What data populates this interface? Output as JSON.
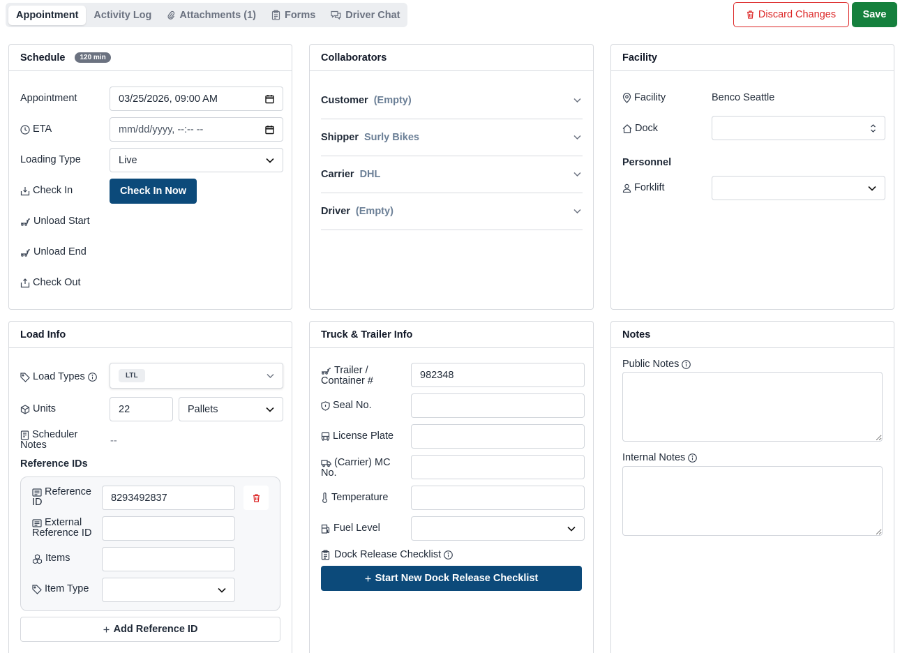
{
  "tabs": [
    {
      "label": "Appointment",
      "icon": "none"
    },
    {
      "label": "Activity Log",
      "icon": "none"
    },
    {
      "label": "Attachments (1)",
      "icon": "paperclip-icon"
    },
    {
      "label": "Forms",
      "icon": "clipboard-icon"
    },
    {
      "label": "Driver Chat",
      "icon": "chat-icon"
    }
  ],
  "actions": {
    "discard": "Discard Changes",
    "save": "Save"
  },
  "colors": {
    "accent": "#0c4a7a",
    "save": "#15803d",
    "danger": "#dc2626",
    "muted_value": "#6b7f96"
  },
  "schedule": {
    "title": "Schedule",
    "badge": "120 min",
    "appointment_label": "Appointment",
    "appointment_value": "03/25/2026, 09:00  AM",
    "eta_label": "ETA",
    "eta_value": "mm/dd/yyyy, --:-- --",
    "loading_type_label": "Loading Type",
    "loading_type_value": "Live",
    "check_in_label": "Check In",
    "check_in_button": "Check In Now",
    "unload_start_label": "Unload Start",
    "unload_end_label": "Unload End",
    "check_out_label": "Check Out"
  },
  "collaborators": {
    "title": "Collaborators",
    "rows": [
      {
        "name": "Customer",
        "value": "(Empty)"
      },
      {
        "name": "Shipper",
        "value": "Surly Bikes"
      },
      {
        "name": "Carrier",
        "value": "DHL"
      },
      {
        "name": "Driver",
        "value": "(Empty)"
      }
    ]
  },
  "facility": {
    "title": "Facility",
    "facility_label": "Facility",
    "facility_value": "Benco Seattle",
    "dock_label": "Dock",
    "dock_value": "",
    "personnel_heading": "Personnel",
    "forklift_label": "Forklift",
    "forklift_value": ""
  },
  "load_info": {
    "title": "Load Info",
    "load_types_label": "Load Types",
    "load_types_chip": "LTL",
    "units_label": "Units",
    "units_value": "22",
    "units_type": "Pallets",
    "scheduler_notes_label_1": "Scheduler",
    "scheduler_notes_label_2": "Notes",
    "scheduler_notes_value": "--",
    "reference_ids_heading": "Reference IDs",
    "reference_id_label_1": "Reference",
    "reference_id_label_2": "ID",
    "reference_id_value": "8293492837",
    "external_ref_label_1": "External",
    "external_ref_label_2": "Reference ID",
    "external_ref_value": "",
    "items_label": "Items",
    "items_value": "",
    "item_type_label": "Item Type",
    "item_type_value": "",
    "add_reference_button": "Add Reference ID"
  },
  "truck": {
    "title": "Truck & Trailer Info",
    "trailer_label_1": "Trailer /",
    "trailer_label_2": "Container #",
    "trailer_value": "982348",
    "seal_label": "Seal No.",
    "seal_value": "",
    "plate_label": "License Plate",
    "plate_value": "",
    "mc_label_1": "(Carrier) MC",
    "mc_label_2": "No.",
    "mc_value": "",
    "temperature_label": "Temperature",
    "temperature_value": "",
    "fuel_label": "Fuel Level",
    "fuel_value": "",
    "checklist_label": "Dock Release Checklist",
    "checklist_button": "Start New Dock Release Checklist"
  },
  "notes": {
    "title": "Notes",
    "public_label": "Public Notes",
    "public_value": "",
    "internal_label": "Internal Notes",
    "internal_value": ""
  }
}
